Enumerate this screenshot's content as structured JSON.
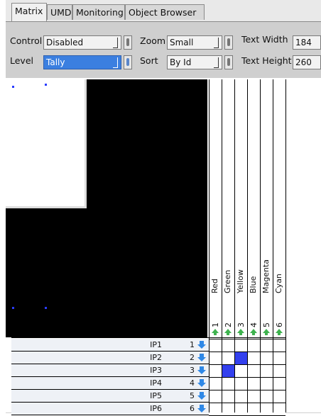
{
  "tabs": [
    {
      "label": "Matrix",
      "active": true
    },
    {
      "label": "UMD",
      "active": false
    },
    {
      "label": "Monitoring",
      "active": false
    },
    {
      "label": "Object Browser",
      "active": false
    }
  ],
  "controls": {
    "control_label": "Control",
    "control_value": "Disabled",
    "level_label": "Level",
    "level_value": "Tally",
    "zoom_label": "Zoom",
    "zoom_value": "Small",
    "sort_label": "Sort",
    "sort_value": "By Id",
    "text_width_label": "Text Width",
    "text_width_value": "184",
    "text_height_label": "Text Height",
    "text_height_value": "260"
  },
  "destinations": [
    {
      "name": "Red",
      "num": "1"
    },
    {
      "name": "Green",
      "num": "2"
    },
    {
      "name": "Yellow",
      "num": "3"
    },
    {
      "name": "Blue",
      "num": "4"
    },
    {
      "name": "Magenta",
      "num": "5"
    },
    {
      "name": "Cyan",
      "num": "6"
    }
  ],
  "sources": [
    {
      "name": "IP1",
      "num": "1"
    },
    {
      "name": "IP2",
      "num": "2"
    },
    {
      "name": "IP3",
      "num": "3"
    },
    {
      "name": "IP4",
      "num": "4"
    },
    {
      "name": "IP5",
      "num": "5"
    },
    {
      "name": "IP6",
      "num": "6"
    }
  ],
  "crosspoints": [
    {
      "source": 1,
      "destination": 2
    },
    {
      "source": 2,
      "destination": 1
    }
  ],
  "colors": {
    "crosspoint": "#3340ee",
    "selection": "#3b7fe0",
    "up_arrow": "#3fb34f",
    "down_arrow": "#2f88e6"
  }
}
